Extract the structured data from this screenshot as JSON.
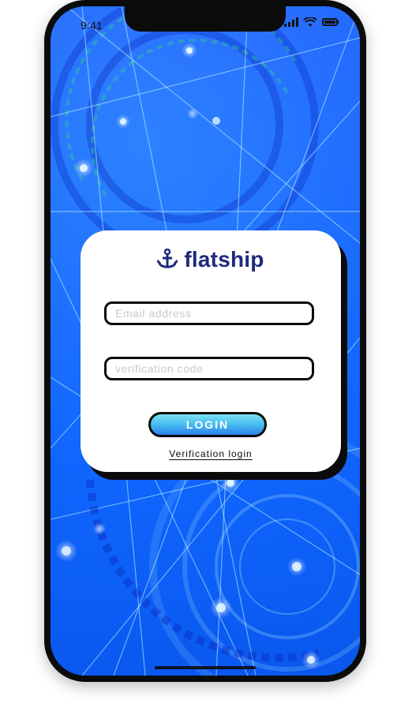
{
  "status_bar": {
    "time": "9:41"
  },
  "brand": {
    "name": "flatship",
    "icon": "anchor-icon",
    "color": "#1f2a7a"
  },
  "form": {
    "email_placeholder": "Email address",
    "code_placeholder": "verification code",
    "login_label": "LOGIN",
    "secondary_link": "Verification login"
  },
  "colors": {
    "background_blue": "#0f52ff",
    "button_gradient_top": "#79e2f0",
    "button_gradient_bottom": "#2a7fe9",
    "outline": "#0b0b0b"
  }
}
